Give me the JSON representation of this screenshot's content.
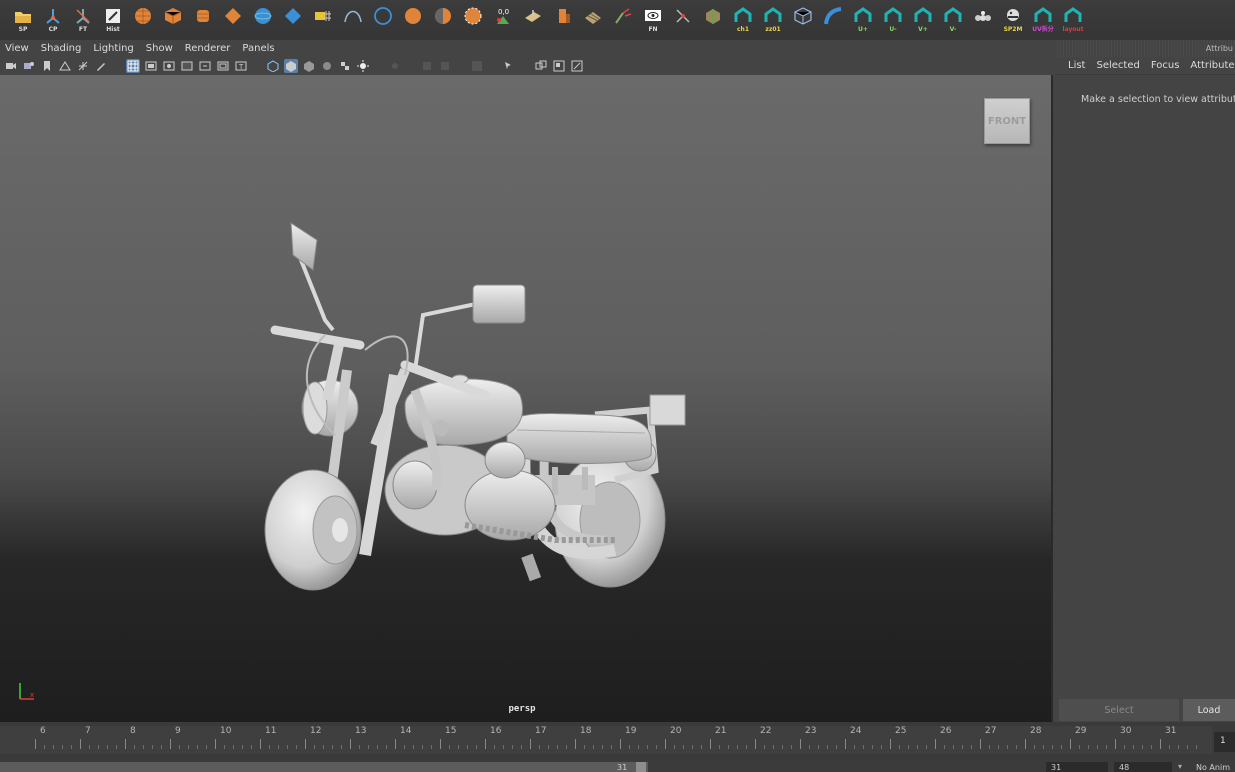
{
  "shelf": {
    "items": [
      {
        "icon": "folder-icon",
        "label": "SP"
      },
      {
        "icon": "center-pivot-icon",
        "label": "CP"
      },
      {
        "icon": "freeze-transform-icon",
        "label": "FT"
      },
      {
        "icon": "history-icon",
        "label": "Hist"
      },
      {
        "icon": "poly-sphere-icon",
        "label": ""
      },
      {
        "icon": "poly-cube-icon",
        "label": ""
      },
      {
        "icon": "poly-cylinder-icon",
        "label": ""
      },
      {
        "icon": "poly-diamond-icon",
        "label": ""
      },
      {
        "icon": "nurbs-sphere-icon",
        "label": ""
      },
      {
        "icon": "nurbs-plane-icon",
        "label": ""
      },
      {
        "icon": "camera-grid-icon",
        "label": ""
      },
      {
        "icon": "curve-icon",
        "label": ""
      },
      {
        "icon": "circle-icon",
        "label": ""
      },
      {
        "icon": "orange-sphere-icon",
        "label": ""
      },
      {
        "icon": "half-sphere-icon",
        "label": ""
      },
      {
        "icon": "smooth-sphere-icon",
        "label": ""
      },
      {
        "icon": "zero-transform-icon",
        "label": ""
      },
      {
        "icon": "plane-tool-icon",
        "label": ""
      },
      {
        "icon": "extrude-icon",
        "label": ""
      },
      {
        "icon": "soft-body-icon",
        "label": ""
      },
      {
        "icon": "paint-tool-icon",
        "label": ""
      },
      {
        "icon": "eye-icon",
        "label": "FN"
      },
      {
        "icon": "snap-tool-icon",
        "label": ""
      },
      {
        "icon": "box-tool-icon",
        "label": ""
      },
      {
        "icon": "uv-script-icon",
        "label": "ch1"
      },
      {
        "icon": "uv-script-icon",
        "label": "zz01"
      },
      {
        "icon": "wireframe-cube-icon",
        "label": ""
      },
      {
        "icon": "bend-icon",
        "label": ""
      },
      {
        "icon": "uv-script-icon",
        "label": "U+"
      },
      {
        "icon": "uv-script-icon",
        "label": "U-"
      },
      {
        "icon": "uv-script-icon",
        "label": "V+"
      },
      {
        "icon": "uv-script-icon",
        "label": "V-"
      },
      {
        "icon": "spheres-icon",
        "label": ""
      },
      {
        "icon": "python-icon",
        "label": "SP2M"
      },
      {
        "icon": "uv-script-icon",
        "label": "UV拆分"
      },
      {
        "icon": "uv-script-icon",
        "label": "layout"
      }
    ]
  },
  "viewport": {
    "menu": [
      "View",
      "Shading",
      "Lighting",
      "Show",
      "Renderer",
      "Panels"
    ],
    "camera_label": "persp",
    "viewcube_label": "FRONT"
  },
  "attr": {
    "header": "Attribu",
    "menu": [
      "List",
      "Selected",
      "Focus",
      "Attributes"
    ],
    "message": "Make a selection to view attributes",
    "select_label": "Select",
    "load_label": "Load"
  },
  "timeline": {
    "ticks": [
      "6",
      "7",
      "8",
      "9",
      "10",
      "11",
      "12",
      "13",
      "14",
      "15",
      "16",
      "17",
      "18",
      "19",
      "20",
      "21",
      "22",
      "23",
      "24",
      "25",
      "26",
      "27",
      "28",
      "29",
      "30",
      "31"
    ],
    "current_frame": "1"
  },
  "range": {
    "slider_end": "31",
    "start": "31",
    "end": "48",
    "anim_layer": "No Anim"
  },
  "colors": {
    "accent": "#5a7fa8",
    "shelf_teal": "#1fb3b3",
    "shelf_orange": "#e0843a",
    "shelf_blue": "#3a8fd6"
  }
}
